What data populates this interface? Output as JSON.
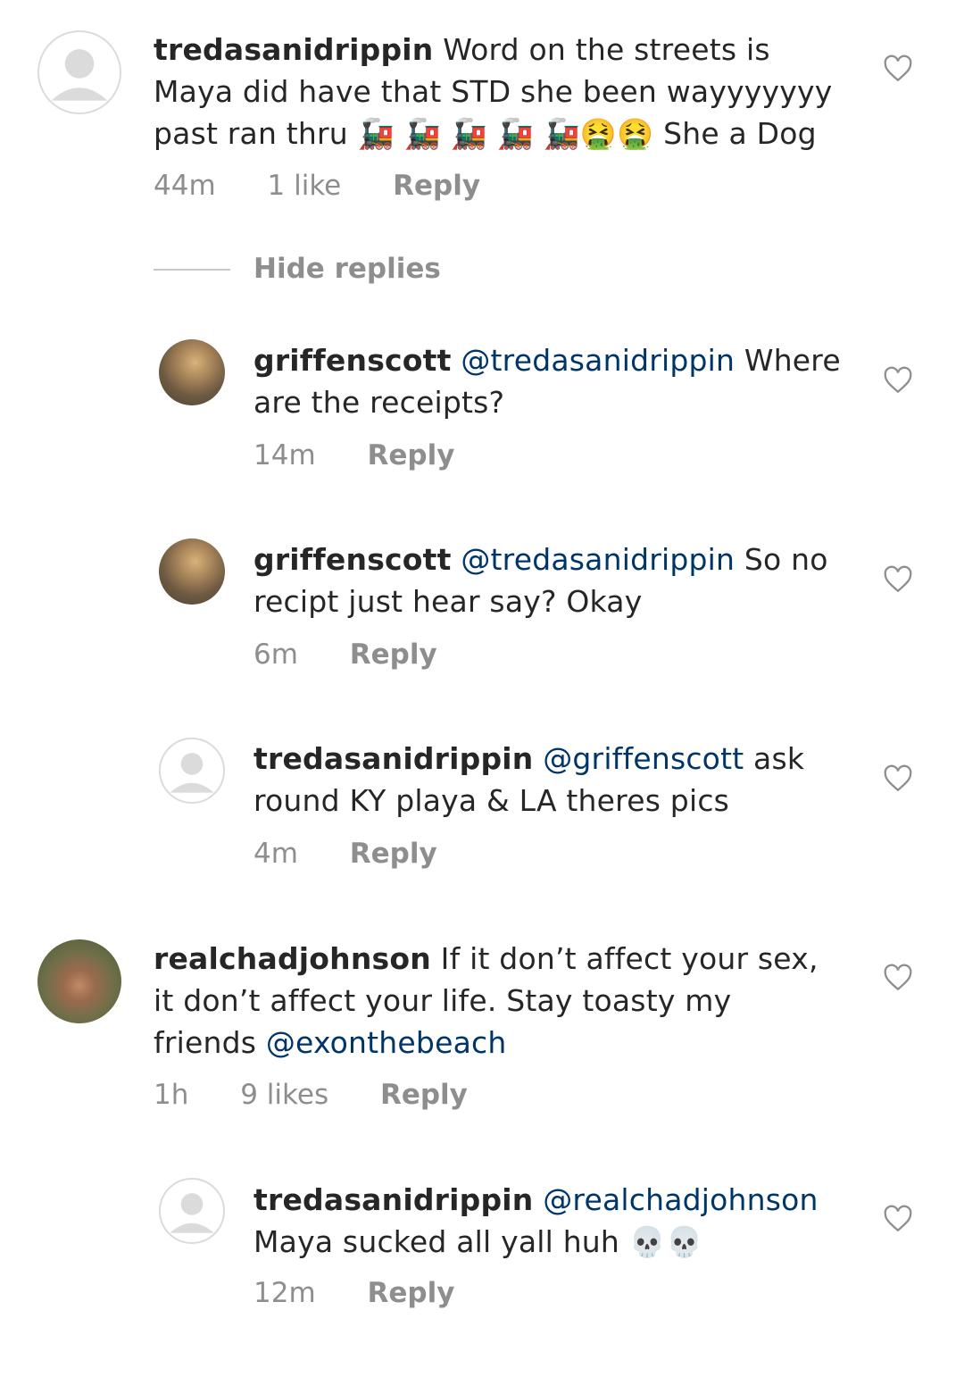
{
  "comments": [
    {
      "username": "tredasanidrippin",
      "text": "Word on the streets is Maya did have that STD she been wayyyyyyy past ran thru 🚂 🚂 🚂 🚂 🚂🤮🤮 She a Dog",
      "time": "44m",
      "likes": "1 like",
      "reply": "Reply",
      "avatar": "default"
    },
    {
      "username": "griffenscott",
      "mention": "@tredasanidrippin",
      "text": "Where are the receipts?",
      "time": "14m",
      "reply": "Reply",
      "avatar": "photo"
    },
    {
      "username": "griffenscott",
      "mention": "@tredasanidrippin",
      "text": "So no recipt just hear say? Okay",
      "time": "6m",
      "reply": "Reply",
      "avatar": "photo"
    },
    {
      "username": "tredasanidrippin",
      "mention": "@griffenscott",
      "text": "ask round KY playa & LA theres pics",
      "time": "4m",
      "reply": "Reply",
      "avatar": "default"
    },
    {
      "username": "realchadjohnson",
      "text": "If it don’t affect your sex, it don’t affect your life. Stay toasty my friends",
      "mention_end": "@exonthebeach",
      "time": "1h",
      "likes": "9 likes",
      "reply": "Reply",
      "avatar": "photo"
    },
    {
      "username": "tredasanidrippin",
      "mention": "@realchadjohnson",
      "text": "Maya sucked all yall huh 💀💀",
      "time": "12m",
      "reply": "Reply",
      "avatar": "default"
    }
  ],
  "hide_replies": "Hide replies",
  "icons": {
    "like": "heart-outline-icon",
    "default_avatar": "default-avatar-icon"
  },
  "colors": {
    "mention": "#003569",
    "meta": "#8e8e8e",
    "text": "#262626"
  }
}
